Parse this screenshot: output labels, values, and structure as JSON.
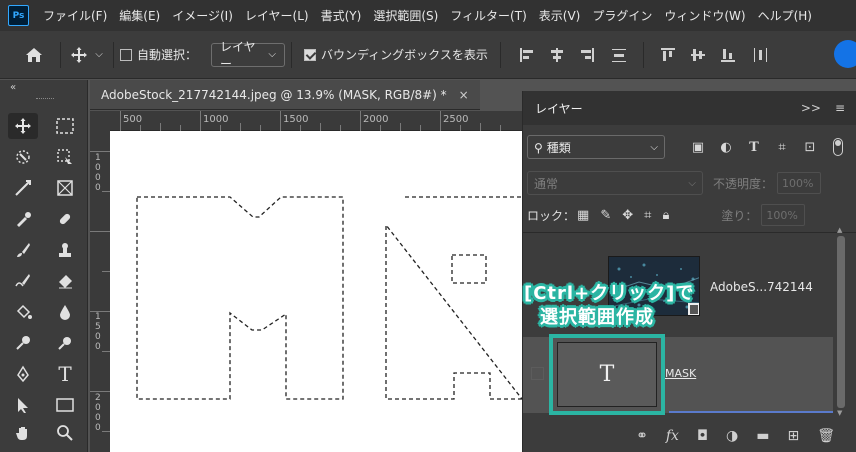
{
  "app": {
    "logo": "Ps"
  },
  "menu": [
    "ファイル(F)",
    "編集(E)",
    "イメージ(I)",
    "レイヤー(L)",
    "書式(Y)",
    "選択範囲(S)",
    "フィルター(T)",
    "表示(V)",
    "プラグイン",
    "ウィンドウ(W)",
    "ヘルプ(H)"
  ],
  "options": {
    "auto_select_label": "自動選択：",
    "auto_select_target": "レイヤー",
    "bounding_box_label": "バウンディングボックスを表示",
    "bounding_box_checked": true,
    "auto_select_checked": false
  },
  "document": {
    "tab_title": "AdobeStock_217742144.jpeg @ 13.9% (MASK, RGB/8#) *",
    "close": "×",
    "ruler_h": [
      "500",
      "1000",
      "1500",
      "2000",
      "2500"
    ],
    "ruler_v": [
      "1000",
      "1500",
      "2000"
    ]
  },
  "layers_panel": {
    "title": "レイヤー",
    "header_icons": {
      "collapse": ">>",
      "menu": "≡"
    },
    "filter_kind": "種類",
    "blend_mode": "通常",
    "opacity_label": "不透明度：",
    "opacity_value": "100%",
    "lock_label": "ロック：",
    "fill_label": "塗り：",
    "fill_value": "100%",
    "layers": [
      {
        "name": "AdobeS...742144",
        "type": "image"
      },
      {
        "name": "MASK",
        "type": "text",
        "thumb_glyph": "T"
      }
    ],
    "bottom_icons": [
      "link-icon",
      "fx-icon",
      "mask-icon",
      "adjustment-icon",
      "folder-icon",
      "new-layer-icon",
      "trash-icon"
    ],
    "bottom_fx": "fx"
  },
  "annotation": {
    "line1": "[Ctrl+クリック]で",
    "line2": "選択範囲作成",
    "accent": "#2bb5a3"
  },
  "colors": {
    "accent_blue": "#1473e6",
    "panel": "#3c3c3c",
    "menubar": "#323232"
  }
}
